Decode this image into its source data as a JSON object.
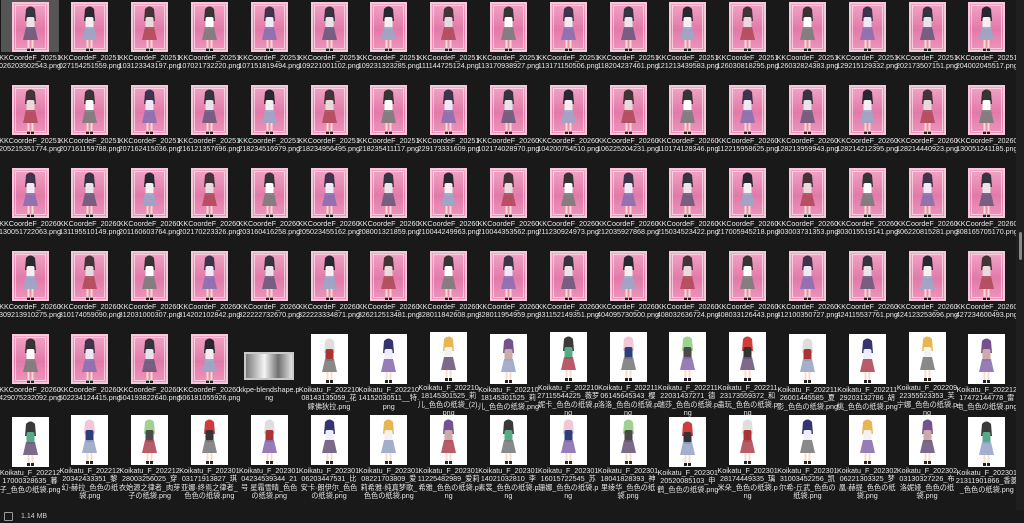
{
  "status": {
    "size": "1.14 MB"
  },
  "rows": [
    [
      "KKCoordeF_20251026203502543.png",
      "KKCoordeF_20251027154251559.png",
      "KKCoordeF_20251103123343197.png",
      "KKCoordeF_20251107021732220.png",
      "KKCoordeF_20251107151819494.png",
      "KKCoordeF_20251109221001102.png",
      "KKCoordeF_20251109231323285.png",
      "KKCoordeF_20251111144725124.png",
      "KKCoordeF_20251113170938927.png",
      "KKCoordeF_20251113171150506.png",
      "KKCoordeF_20251118204237461.png",
      "KKCoordeF_20251121213439583.png",
      "KKCoordeF_20251126030818295.png",
      "KKCoordeF_20251126032824383.png",
      "KKCoordeF_20251129215129332.png",
      "KKCoordeF_20251202173507151.png",
      "KKCoordeF_20251204002045517.png"
    ],
    [
      "KKCoordeF_20251205215351774.png",
      "KKCoordeF_20251207161159788.png",
      "KKCoordeF_20251207162415036.png",
      "KKCoordeF_20251216121357696.png",
      "KKCoordeF_20251218234516979.png",
      "KKCoordeF_20251218234956495.png",
      "KKCoordeF_20251218235411117.png",
      "KKCoordeF_20251229173331609.png",
      "KKCoordeF_20260102174028970.png",
      "KKCoordeF_20260104200754510.png",
      "KKCoordeF_20260106225204231.png",
      "KKCoordeF_20260110174128346.png",
      "KKCoordeF_20260112215958625.png",
      "KKCoordeF_20260128213959943.png",
      "KKCoordeF_20260128214212395.png",
      "KKCoordeF_20260128214440923.png",
      "KKCoordeF_20260130051241185.png"
    ],
    [
      "KKCoordeF_20260130051722063.png",
      "KKCoordeF_20260131195510149.png",
      "KKCoordeF_20260201160603764.png",
      "KKCoordeF_20260202170223326.png",
      "KKCoordeF_20260203160416258.png",
      "KKCoordeF_20260205023455162.png",
      "KKCoordeF_20260208001321859.png",
      "KKCoordeF_20260210044249963.png",
      "KKCoordeF_20260210044353562.png",
      "KKCoordeF_20260211230924973.png",
      "KKCoordeF_20260212035927868.png",
      "KKCoordeF_20260215034523422.png",
      "KKCoordeF_20260217005945218.png",
      "KKCoordeF_20260303003731353.png",
      "KKCoordeF_20260303015519141.png",
      "KKCoordeF_20260306220815281.png",
      "KKCoordeF_20260308165705170.png"
    ],
    [
      "KKCoordeF_20260309213910275.png",
      "KKCoordeF_20260310174059090.png",
      "KKCoordeF_20260312031000307.png",
      "KKCoordeF_20260314202102842.png",
      "KKCoordeF_20260322222732670.png",
      "KKCoordeF_20260322223334871.png",
      "KKCoordeF_20260326212513481.png",
      "KKCoordeF_20260328011842608.png",
      "KKCoordeF_20260328011954959.png",
      "KKCoordeF_20260331152149351.png",
      "KKCoordeF_20260404095730500.png",
      "KKCoordeF_20260408032636724.png",
      "KKCoordeF_20260408033126443.png",
      "KKCoordeF_20260412100350727.png",
      "KKCoordeF_20260424115537761.png",
      "KKCoordeF_20260424123253696.png",
      "KKCoordeF_20260427234600493.png"
    ],
    [
      "KKCoordeF_20260429075232092.png",
      "KKCoordeF_20260502234124415.png",
      "KKCoordeF_20260504193822640.png",
      "KKCoordeF_20260506181055926.png",
      "kkpe-blendshape.png",
      "Koikatu_F_20221008143135059_花嫁佛狄拉.png",
      "Koikatu_F_20221014152030511__特.png",
      "Koikatu_F_20221018145301525_莉儿_色色の纸袋_(2).png",
      "Koikatu_F_20221018145301525_莉儿_色色の纸袋.png",
      "Koikatu_F_20221027115544225_薇罗妮卡_色色の纸袋.png",
      "Koikatu_F_20221106145645343_樱洛洛_色色の纸袋.png",
      "Koikatu_F_20221122031437271_德瑞莎_色色の纸袋.png",
      "Koikatu_F_20221123173559372_和蛊玩_色色の纸袋.png",
      "Koikatu_F_20221126001445585_夏影_色色の纸袋.png",
      "Koikatu_F_20221129203132786_胡桃_色色の纸袋.png",
      "Koikatu_F_20220922355523353_芙宁娜_色色の纸袋.png",
      "Koikatu_F_20221217472144778_雷电_色色の纸袋.png"
    ],
    [
      "Koikatu_F_20221217000328635_暮子_色色の纸袋.png",
      "Koikatu_F_20221220342433351_黎幻-赫拉_色色の纸袋.png",
      "Koikatu_F_20221228003256025_穿衣始源之律者_肉芽子の纸袋.png",
      "Koikatu_F_20230103171913827_琪亚娜·终焉之律者_色色の纸袋.png",
      "Koikatu_F_20230104234539344_21号 星霜雪晴_色色の纸袋.png",
      "Koikatu_F_20230106203447531_比安卡·朗伊尔_色色の纸袋.png",
      "Koikatu_F_20230108221703809_爱莉希雅·纯真梦歌_色色の纸袋.png",
      "Koikatu_F_20230111225482989_爱莉希雅_色色の纸袋.png",
      "Koikatu_F_20230114021032810_李素裳_色色の纸袋.png",
      "Koikatu_F_20230116015722545_苏珊娜_色色の纸袋.png",
      "Koikatu_F_20230118041828393_神里绫华_色色の纸袋.png",
      "Koikatu_F_20230120520085103_申鹤_色色の纸袋.png",
      "Koikatu_F_20230128174449335_璃米朵_色色の纸袋.png",
      "Koikatu_F_20230131003452256_凯尔希-丘武_色色の纸袋.png",
      "Koikatu_F_20230206221303325_梦凰·赫提_色色の纸袋.png",
      "Koikatu_F_20230203130327226_布洛妮娅_色色の纸袋.png",
      "Koikatu_F_20230121311901866_香菱_色色の纸袋.png"
    ]
  ],
  "thumb_kinds": [
    "card",
    "card",
    "card",
    "card",
    "card",
    "card"
  ],
  "row5_kinds": [
    "card",
    "card",
    "card",
    "card",
    "blend",
    "white",
    "white",
    "white",
    "white",
    "white",
    "white",
    "white",
    "white",
    "white",
    "white",
    "white",
    "white"
  ],
  "row6_kind": "white"
}
